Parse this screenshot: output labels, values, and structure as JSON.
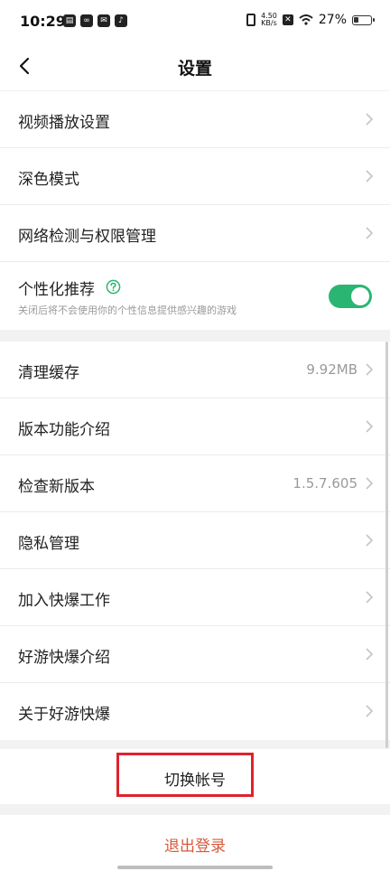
{
  "status": {
    "time": "10:29",
    "speed_top": "4.50",
    "speed_bottom": "KB/s",
    "battery": "27%",
    "x_badge": "✕"
  },
  "header": {
    "title": "设置"
  },
  "group1": [
    {
      "label": "视频播放设置"
    },
    {
      "label": "深色模式"
    },
    {
      "label": "网络检测与权限管理"
    }
  ],
  "personalize": {
    "label": "个性化推荐",
    "description": "关闭后将不会使用你的个性信息提供感兴趣的游戏",
    "enabled": true
  },
  "group2": [
    {
      "label": "清理缓存",
      "value": "9.92MB"
    },
    {
      "label": "版本功能介绍",
      "value": ""
    },
    {
      "label": "检查新版本",
      "value": "1.5.7.605"
    },
    {
      "label": "隐私管理",
      "value": ""
    },
    {
      "label": "加入快爆工作",
      "value": ""
    },
    {
      "label": "好游快爆介绍",
      "value": ""
    },
    {
      "label": "关于好游快爆",
      "value": ""
    }
  ],
  "switch_account": {
    "label": "切换帐号"
  },
  "logout": {
    "label": "退出登录"
  },
  "colors": {
    "toggle_on": "#2bb573",
    "logout": "#d75a3b",
    "highlight": "#e0222d"
  }
}
